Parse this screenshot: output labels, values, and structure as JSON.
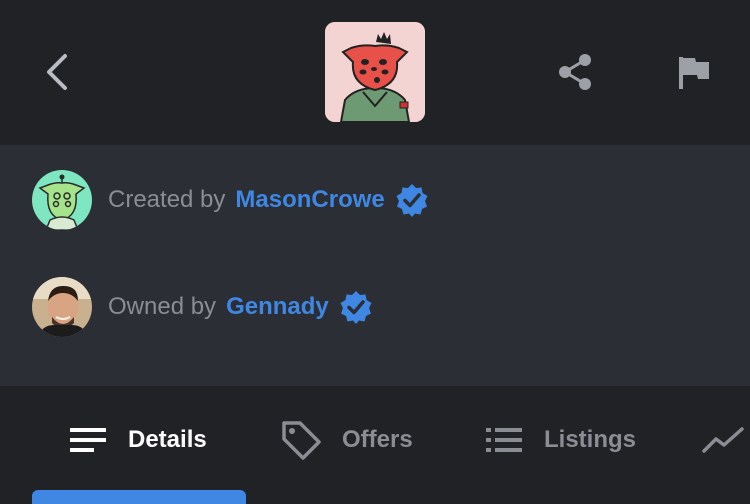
{
  "header": {
    "back_icon": "chevron-left-icon",
    "share_icon": "share-icon",
    "flag_icon": "flag-icon"
  },
  "creator": {
    "prefix": "Created by",
    "name": "MasonCrowe",
    "verified_icon": "verified-badge-icon"
  },
  "owner": {
    "prefix": "Owned by",
    "name": "Gennady",
    "verified_icon": "verified-badge-icon"
  },
  "tabs": [
    {
      "label": "Details",
      "icon": "details-lines-icon",
      "active": true
    },
    {
      "label": "Offers",
      "icon": "tag-icon",
      "active": false
    },
    {
      "label": "Listings",
      "icon": "list-icon",
      "active": false
    },
    {
      "label": "",
      "icon": "activity-chart-icon",
      "active": false
    }
  ],
  "colors": {
    "background": "#202226",
    "panel": "#2b2e35",
    "accent": "#3f87e3",
    "muted_text": "#8a8d93"
  }
}
